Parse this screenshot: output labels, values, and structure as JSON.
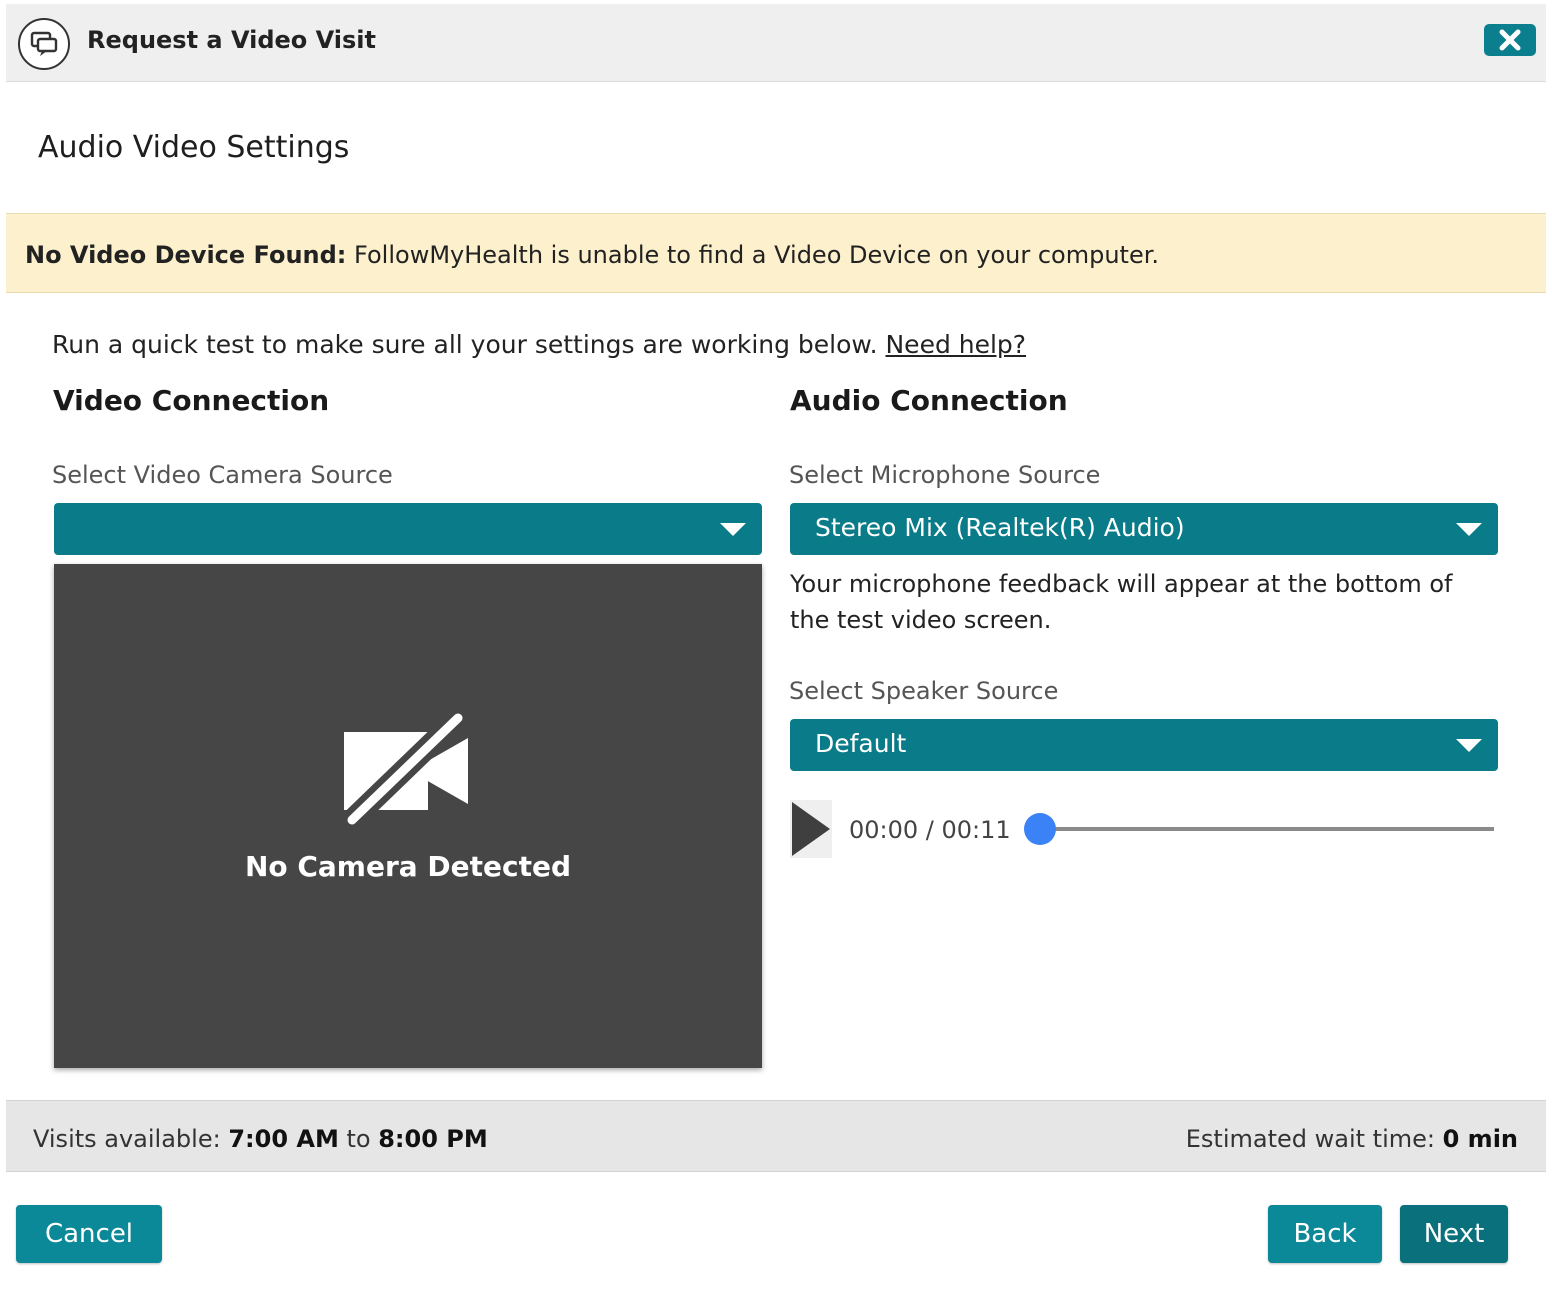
{
  "window": {
    "title": "Request a Video Visit",
    "title_icon": "chat-bubbles-icon",
    "close_icon": "close-x-icon"
  },
  "page": {
    "heading": "Audio Video Settings"
  },
  "alert": {
    "bold_text": "No Video Device Found:",
    "message": " FollowMyHealth is unable to find a Video Device on your computer."
  },
  "intro": {
    "text": "Run a quick test to make sure all your settings are working below. ",
    "help_link": "Need help?"
  },
  "video": {
    "section_title": "Video Connection",
    "camera_label": "Select Video Camera Source",
    "camera_selected": "",
    "no_camera_icon": "camera-off-icon",
    "no_camera_text": "No Camera Detected"
  },
  "audio": {
    "section_title": "Audio Connection",
    "mic_label": "Select Microphone Source",
    "mic_selected": "Stereo Mix (Realtek(R) Audio)",
    "mic_note": "Your microphone feedback will appear at the bottom of the test video screen.",
    "speaker_label": "Select Speaker Source",
    "speaker_selected": "Default",
    "player": {
      "time": "00:00 / 00:11",
      "progress": 0
    }
  },
  "footer": {
    "visits_label": "Visits available: ",
    "visits_start": "7:00 AM",
    "visits_to": " to ",
    "visits_end": "8:00 PM",
    "wait_label": "Estimated wait time: ",
    "wait_value": "0 min"
  },
  "buttons": {
    "cancel": "Cancel",
    "back": "Back",
    "next": "Next"
  },
  "colors": {
    "accent": "#0a7b88",
    "alert_bg": "#fdf0cc",
    "slider_thumb": "#3b82f6",
    "video_bg": "#464646"
  }
}
